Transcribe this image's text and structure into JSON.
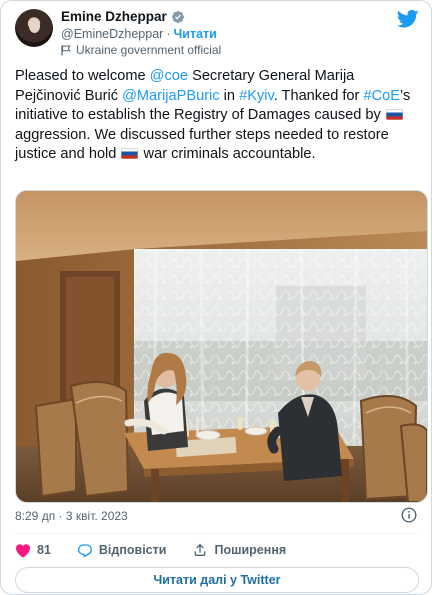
{
  "author": {
    "name": "Emine Dzheppar",
    "handle": "@EmineDzheppar",
    "separator": "·",
    "follow_label": "Читати",
    "gov_label": "Ukraine government official"
  },
  "tweet": {
    "parts": [
      {
        "text": "Pleased to welcome ",
        "kind": "text"
      },
      {
        "text": "@coe",
        "kind": "mention"
      },
      {
        "text": " Secretary General Marija Pejčinović Burić ",
        "kind": "text"
      },
      {
        "text": "@MarijaPBuric",
        "kind": "mention"
      },
      {
        "text": " in ",
        "kind": "text"
      },
      {
        "text": "#Kyiv",
        "kind": "hashtag"
      },
      {
        "text": ". Thanked for ",
        "kind": "text"
      },
      {
        "text": "#CoE",
        "kind": "hashtag"
      },
      {
        "text": "’s initiative to establish the Registry of Damages caused by ",
        "kind": "text"
      },
      {
        "text": "",
        "kind": "flag"
      },
      {
        "text": " aggression. We discussed further steps needed to restore justice and hold ",
        "kind": "text"
      },
      {
        "text": "",
        "kind": "flag"
      },
      {
        "text": " war criminals accountable.",
        "kind": "text"
      }
    ]
  },
  "meta": {
    "time": "8:29 дп",
    "separator": "·",
    "date": "3 квіт. 2023"
  },
  "actions": {
    "likes": "81",
    "reply_label": "Відповісти",
    "share_label": "Поширення"
  },
  "read_more_label": "Читати далі у Twitter",
  "colors": {
    "accent": "#1d9bf0",
    "like": "#f91880",
    "muted": "#536471"
  }
}
